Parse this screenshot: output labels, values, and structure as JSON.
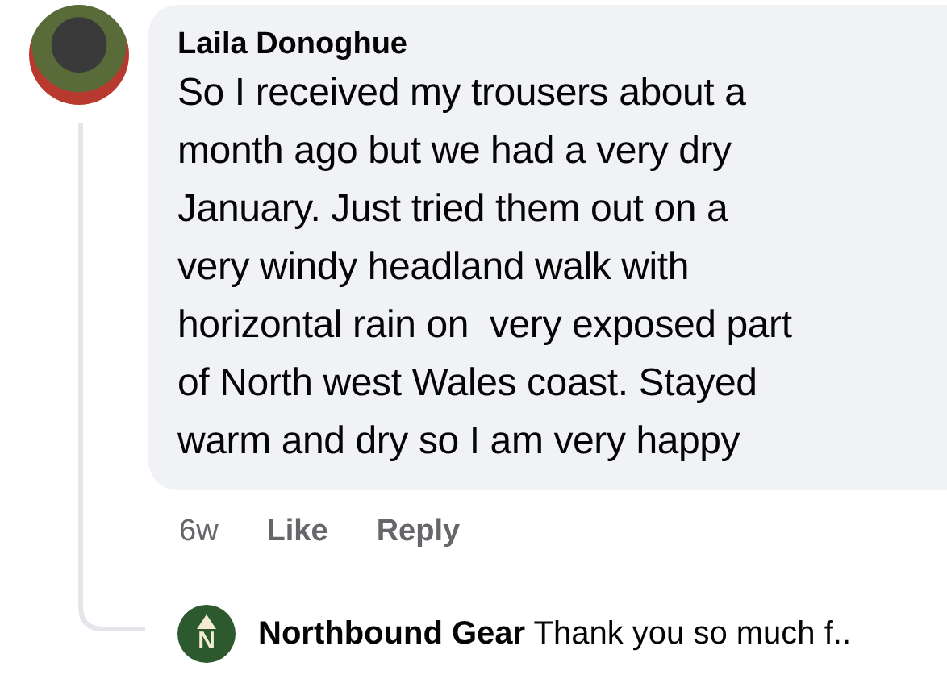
{
  "comment": {
    "author": "Laila Donoghue",
    "text": "So I received my trousers about a\nmonth ago but we had a very dry\nJanuary. Just tried them out on a\nvery windy headland walk with\nhorizontal rain on  very exposed part\nof North west Wales coast. Stayed\nwarm and dry so I am very happy",
    "time": "6w",
    "actions": [
      "Like",
      "Reply"
    ]
  },
  "reply": {
    "logo_letter": "N",
    "author": "Northbound Gear",
    "text": "Thank you so much f.."
  }
}
